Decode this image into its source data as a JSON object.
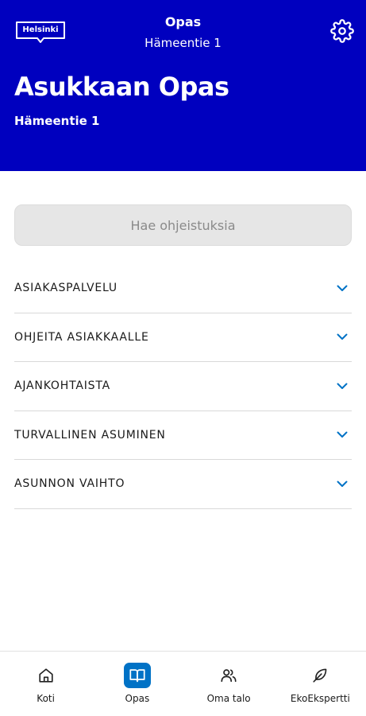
{
  "header": {
    "logo_text": "Helsinki",
    "title": "Opas",
    "subtitle": "Hämeentie 1",
    "hero_title": "Asukkaan Opas",
    "hero_subtitle": "Hämeentie 1",
    "settings_icon": "gear-icon",
    "background_color": "#0000bf"
  },
  "search": {
    "placeholder": "Hae ohjeistuksia"
  },
  "sections": [
    {
      "label": "ASIAKASPALVELU"
    },
    {
      "label": "OHJEITA ASIAKKAALLE"
    },
    {
      "label": "AJANKOHTAISTA"
    },
    {
      "label": "TURVALLINEN ASUMINEN"
    },
    {
      "label": "ASUNNON VAIHTO"
    }
  ],
  "accent_color": "#0072c6",
  "bottom_nav": [
    {
      "label": "Koti",
      "icon": "home-icon",
      "active": false
    },
    {
      "label": "Opas",
      "icon": "book-icon",
      "active": true
    },
    {
      "label": "Oma talo",
      "icon": "users-icon",
      "active": false
    },
    {
      "label": "EkoEkspertti",
      "icon": "leaf-icon",
      "active": false
    }
  ]
}
